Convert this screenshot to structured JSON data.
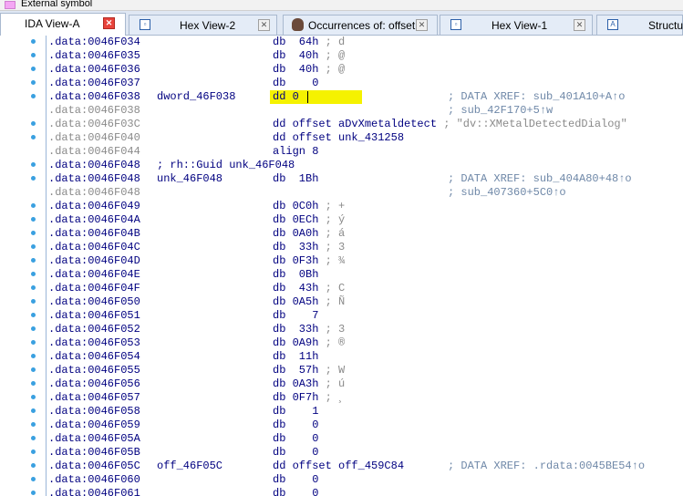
{
  "topbar": {
    "label": "External symbol",
    "swatch_color": "#f4a6f4"
  },
  "tabs": [
    {
      "label": "IDA View-A",
      "active": true
    },
    {
      "label": "Hex View-2",
      "active": false
    },
    {
      "label": "Occurrences of: offset",
      "active": false
    },
    {
      "label": "Hex View-1",
      "active": false
    },
    {
      "label": "Structur",
      "active": false
    }
  ],
  "lines": [
    {
      "addr": ".data:0046F034",
      "instr": "db  64h",
      "comment": "; d"
    },
    {
      "addr": ".data:0046F035",
      "instr": "db  40h",
      "comment": "; @"
    },
    {
      "addr": ".data:0046F036",
      "instr": "db  40h",
      "comment": "; @"
    },
    {
      "addr": ".data:0046F037",
      "instr": "db    0",
      "comment": ""
    },
    {
      "addr": ".data:0046F038",
      "label": "dword_46F038",
      "instr": "dd 0",
      "xref": "; DATA XREF: sub_401A10+A↑o"
    },
    {
      "addr": ".data:0046F038",
      "xref": "; sub_42F170+5↑w"
    },
    {
      "addr": ".data:0046F03C",
      "instr": "dd offset aDvXmetaldetect",
      "comment": "; \"dv::XMetalDetectedDialog\""
    },
    {
      "addr": ".data:0046F040",
      "instr": "dd offset unk_431258"
    },
    {
      "addr": ".data:0046F044",
      "instr": "align 8"
    },
    {
      "addr": ".data:0046F048",
      "label": "; rh::Guid unk_46F048"
    },
    {
      "addr": ".data:0046F048",
      "label": "unk_46F048",
      "instr": "db  1Bh",
      "xref": "; DATA XREF: sub_404A80+48↑o"
    },
    {
      "addr": ".data:0046F048",
      "xref": "; sub_407360+5C0↑o"
    },
    {
      "addr": ".data:0046F049",
      "instr": "db 0C0h",
      "comment": "; +"
    },
    {
      "addr": ".data:0046F04A",
      "instr": "db 0ECh",
      "comment": "; ý"
    },
    {
      "addr": ".data:0046F04B",
      "instr": "db 0A0h",
      "comment": "; á"
    },
    {
      "addr": ".data:0046F04C",
      "instr": "db  33h",
      "comment": "; 3"
    },
    {
      "addr": ".data:0046F04D",
      "instr": "db 0F3h",
      "comment": "; ¾"
    },
    {
      "addr": ".data:0046F04E",
      "instr": "db  0Bh",
      "comment": ""
    },
    {
      "addr": ".data:0046F04F",
      "instr": "db  43h",
      "comment": "; C"
    },
    {
      "addr": ".data:0046F050",
      "instr": "db 0A5h",
      "comment": "; Ñ"
    },
    {
      "addr": ".data:0046F051",
      "instr": "db    7",
      "comment": ""
    },
    {
      "addr": ".data:0046F052",
      "instr": "db  33h",
      "comment": "; 3"
    },
    {
      "addr": ".data:0046F053",
      "instr": "db 0A9h",
      "comment": "; ®"
    },
    {
      "addr": ".data:0046F054",
      "instr": "db  11h",
      "comment": ""
    },
    {
      "addr": ".data:0046F055",
      "instr": "db  57h",
      "comment": "; W"
    },
    {
      "addr": ".data:0046F056",
      "instr": "db 0A3h",
      "comment": "; ú"
    },
    {
      "addr": ".data:0046F057",
      "instr": "db 0F7h",
      "comment": "; ¸"
    },
    {
      "addr": ".data:0046F058",
      "instr": "db    1",
      "comment": ""
    },
    {
      "addr": ".data:0046F059",
      "instr": "db    0",
      "comment": ""
    },
    {
      "addr": ".data:0046F05A",
      "instr": "db    0",
      "comment": ""
    },
    {
      "addr": ".data:0046F05B",
      "instr": "db    0",
      "comment": ""
    },
    {
      "addr": ".data:0046F05C",
      "label": "off_46F05C",
      "instr": "dd offset off_459C84",
      "xref": "; DATA XREF: .rdata:0045BE54↑o"
    },
    {
      "addr": ".data:0046F060",
      "instr": "db    0",
      "comment": ""
    },
    {
      "addr": ".data:0046F061",
      "instr": "db    0",
      "comment": ""
    }
  ],
  "highlight_color": "#f5f200"
}
